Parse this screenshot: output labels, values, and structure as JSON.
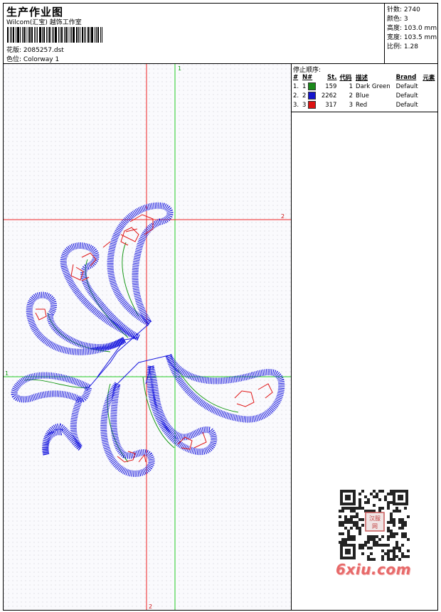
{
  "header": {
    "title": "生产作业图",
    "company": "Wilcom(汇宝) 越饰工作室",
    "design_label": "花版:",
    "design_value": "2085257.dst",
    "colorway_label": "色位:",
    "colorway_value": "Colorway 1"
  },
  "stats": [
    {
      "label": "针数:",
      "value": "2740"
    },
    {
      "label": "颜色:",
      "value": "3"
    },
    {
      "label": "高度:",
      "value": "103.0 mm"
    },
    {
      "label": "宽度:",
      "value": "103.5 mm"
    },
    {
      "label": "比例:",
      "value": "1.28"
    }
  ],
  "stop_sequence": {
    "title": "停止顺序:",
    "columns": [
      "#",
      "N#",
      "St.",
      "代码",
      "描述",
      "Brand",
      "元素"
    ],
    "rows": [
      {
        "no": "1.",
        "n": "1",
        "color": "#1a8a1a",
        "st": "159",
        "code": "1",
        "desc": "Dark Green",
        "brand": "Default"
      },
      {
        "no": "2.",
        "n": "2",
        "color": "#1414cc",
        "st": "2262",
        "code": "2",
        "desc": "Blue",
        "brand": "Default"
      },
      {
        "no": "3.",
        "n": "3",
        "color": "#dd1111",
        "st": "317",
        "code": "3",
        "desc": "Red",
        "brand": "Default"
      }
    ]
  },
  "axes": {
    "v1": "1",
    "h2": "2",
    "h1": "1",
    "v2": "2"
  },
  "watermark": "6xiu.com",
  "qr_logo": "汉服 网"
}
